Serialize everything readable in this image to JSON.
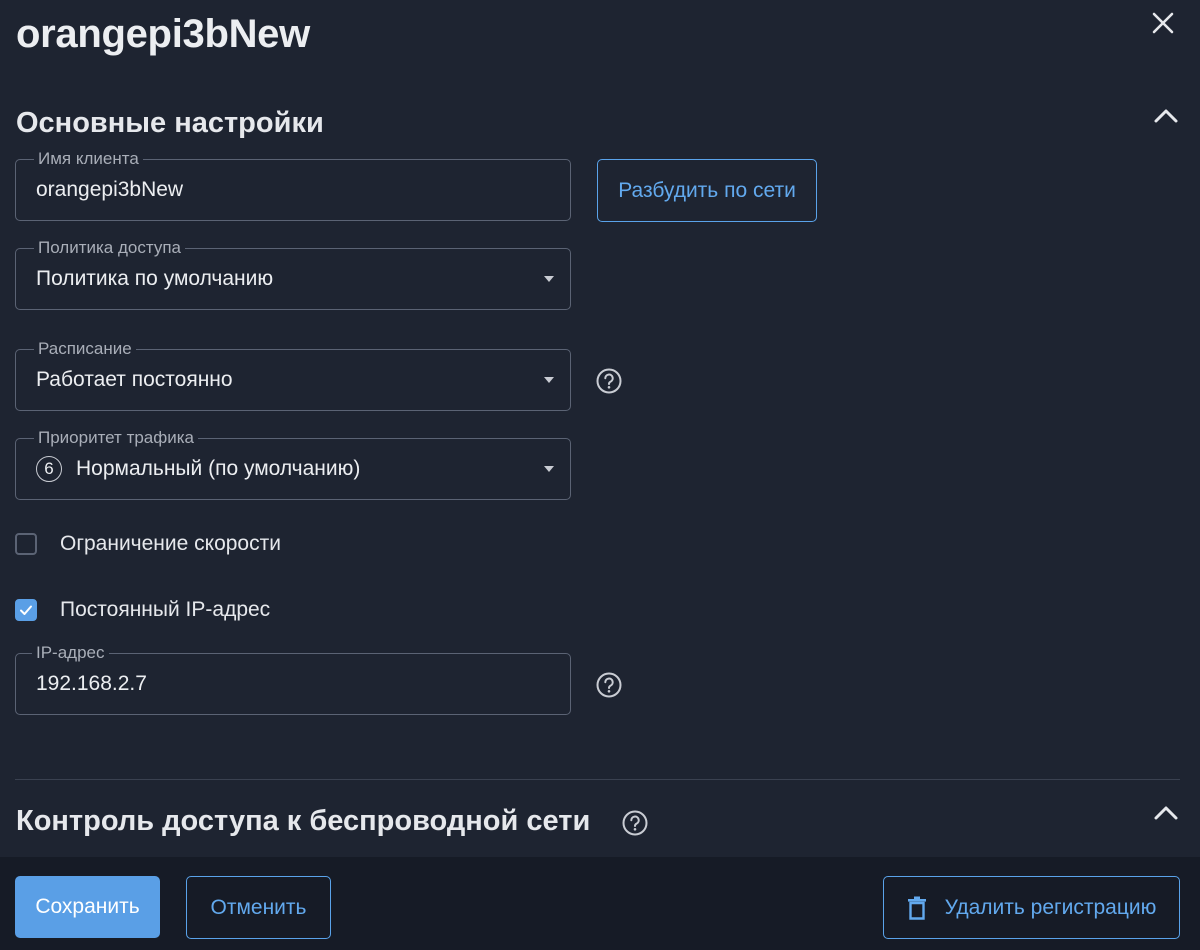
{
  "header": {
    "title": "orangepi3bNew",
    "close_icon": "close-icon"
  },
  "basic_settings": {
    "title": "Основные настройки",
    "client_name": {
      "label": "Имя клиента",
      "value": "orangepi3bNew"
    },
    "wake_button": "Разбудить по сети",
    "access_policy": {
      "label": "Политика доступа",
      "value": "Политика по умолчанию"
    },
    "schedule": {
      "label": "Расписание",
      "value": "Работает постоянно"
    },
    "traffic_priority": {
      "label": "Приоритет трафика",
      "icon_value": "6",
      "value": "Нормальный (по умолчанию)"
    },
    "speed_limit": {
      "label": "Ограничение скорости",
      "checked": false
    },
    "static_ip": {
      "label": "Постоянный IP-адрес",
      "checked": true
    },
    "ip_address": {
      "label": "IP-адрес",
      "value": "192.168.2.7"
    }
  },
  "wireless_section": {
    "title": "Контроль доступа к беспроводной сети"
  },
  "footer": {
    "save": "Сохранить",
    "cancel": "Отменить",
    "delete": "Удалить регистрацию"
  },
  "colors": {
    "background": "#1e2431",
    "footer": "#161b26",
    "accent": "#5a9fe6",
    "border": "#5b6374"
  }
}
